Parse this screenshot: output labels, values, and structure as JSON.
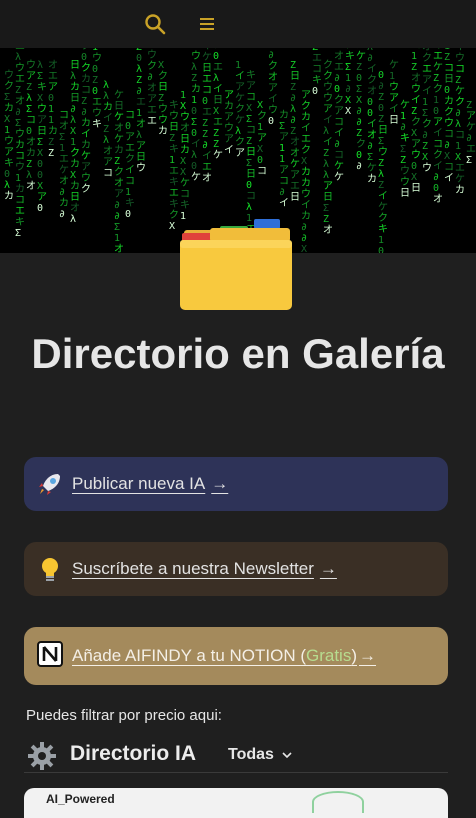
{
  "header": {
    "search_icon": "search-icon",
    "menu_icon": "menu-icon",
    "accent": "#c9a227"
  },
  "hero": {
    "folder_icon": "folder-icon"
  },
  "page_title": "Directorio en Galería",
  "cards": [
    {
      "emoji": "rocket-icon",
      "label": "Publicar nueva IA",
      "arrow": "→",
      "bg": "#2e3358"
    },
    {
      "emoji": "lightbulb-icon",
      "label": "Suscríbete a nuestra Newsletter",
      "arrow": "→",
      "bg": "#3a2f25"
    },
    {
      "emoji": "notion-icon",
      "label_pre": "Añade AIFINDY a tu NOTION (",
      "label_green": "Gratis",
      "label_post": ")",
      "arrow": "→",
      "bg": "#a48a5c"
    }
  ],
  "filter_text": "Puedes filtrar por precio aqui:",
  "directory": {
    "icon": "gear-icon",
    "title": "Directorio IA",
    "selected_filter": "Todas"
  },
  "next_card": {
    "label": "AI_Powered"
  }
}
